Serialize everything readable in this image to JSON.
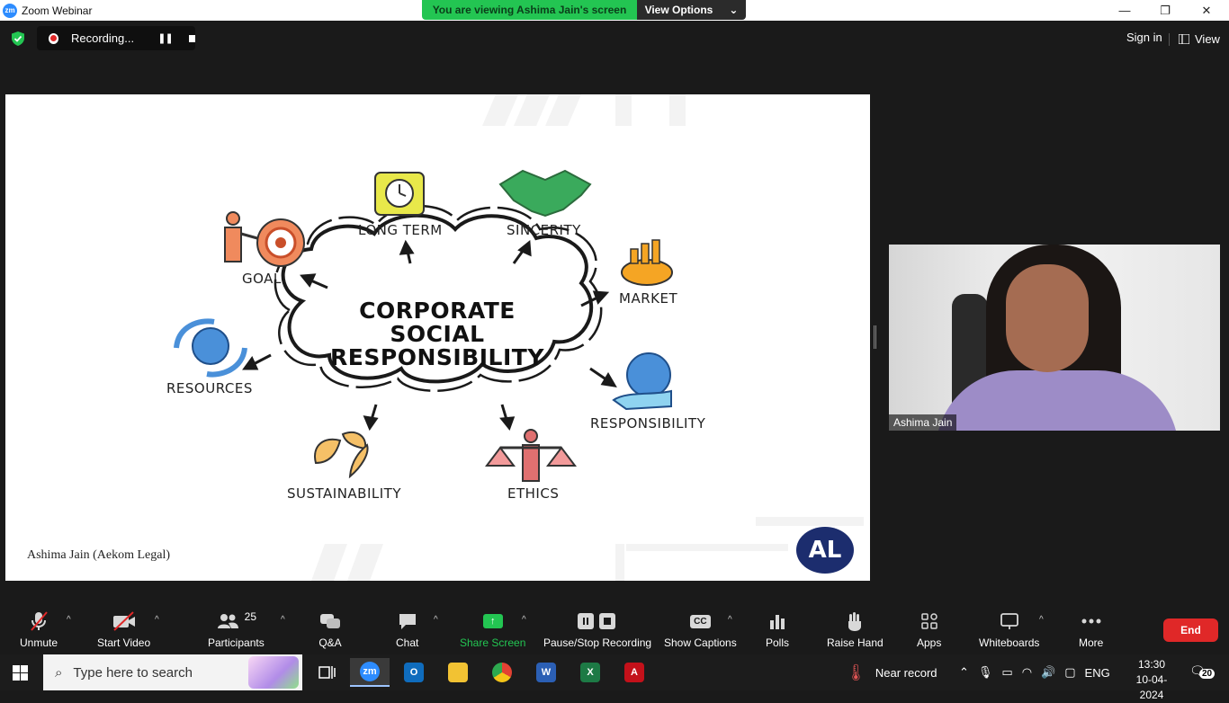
{
  "window": {
    "title": "Zoom Webinar",
    "app_icon_text": "zm",
    "minimize": "—",
    "restore": "❐",
    "close": "✕"
  },
  "banner": {
    "viewing_text": "You are viewing Ashima Jain's screen",
    "view_options_label": "View Options",
    "view_options_caret": "⌄"
  },
  "topbar": {
    "recording_label": "Recording...",
    "pause_glyph": "❚❚",
    "sign_in_label": "Sign in",
    "view_label": "View"
  },
  "slide": {
    "title_lines": [
      "CORPORATE",
      "SOCIAL",
      "RESPONSIBILITY"
    ],
    "labels": {
      "goal": "GOAL",
      "long_term": "LONG TERM",
      "sincerity": "SINCERITY",
      "market": "MARKET",
      "resources": "RESOURCES",
      "responsibility": "RESPONSIBILITY",
      "sustainability": "SUSTAINABILITY",
      "ethics": "ETHICS"
    },
    "presenter_credit": "Ashima Jain (Aekom Legal)",
    "logo_text": "AL"
  },
  "video": {
    "participant_name": "Ashima Jain"
  },
  "toolbar": {
    "unmute": "Unmute",
    "start_video": "Start Video",
    "participants": "Participants",
    "participants_count": "25",
    "qa": "Q&A",
    "chat": "Chat",
    "share_screen": "Share Screen",
    "pause_stop_recording": "Pause/Stop Recording",
    "show_captions": "Show Captions",
    "captions_icon_text": "CC",
    "polls": "Polls",
    "raise_hand": "Raise Hand",
    "apps": "Apps",
    "whiteboards": "Whiteboards",
    "more": "More",
    "end": "End",
    "caret": "^"
  },
  "taskbar": {
    "search_placeholder": "Type here to search",
    "weather": "Near record",
    "language": "ENG",
    "time": "13:30",
    "date": "10-04-2024",
    "notification_count": "20",
    "apps": [
      {
        "name": "zoom",
        "text": "zm",
        "color": "#2d8cff"
      },
      {
        "name": "outlook",
        "text": "O",
        "color": "#0f6cbd"
      },
      {
        "name": "file-explorer",
        "text": "",
        "color": "#f2c233"
      },
      {
        "name": "chrome",
        "text": "",
        "color": "#e34133"
      },
      {
        "name": "word",
        "text": "W",
        "color": "#2b5fb4"
      },
      {
        "name": "excel",
        "text": "X",
        "color": "#1d7a45"
      },
      {
        "name": "acrobat",
        "text": "A",
        "color": "#c3111a"
      }
    ]
  },
  "colors": {
    "accent_green": "#23c552",
    "end_red": "#e02828",
    "toolbar_bg": "#1a1a1a",
    "logo_navy": "#1c2d6e"
  }
}
